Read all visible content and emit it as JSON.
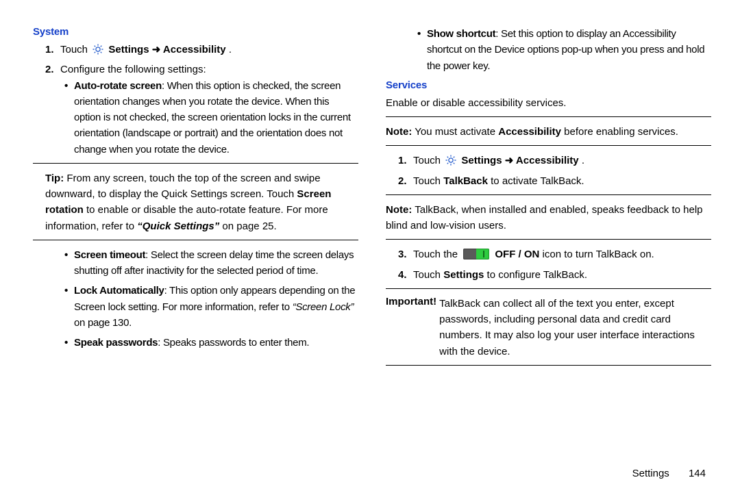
{
  "left": {
    "heading": "System",
    "step1_pre": "Touch ",
    "step1_settings": "Settings",
    "step1_arrow": " ➜ ",
    "step1_acc": "Accessibility",
    "step1_post": ".",
    "step2": "Configure the following settings:",
    "b1_strong": "Auto-rotate screen",
    "b1_rest": ": When this option is checked, the screen orientation changes when you rotate the device. When this option is not checked, the screen orientation locks in the current orientation (landscape or portrait) and the orientation does not change when you rotate the device.",
    "tip_label": "Tip:",
    "tip_body1": " From any screen, touch the top of the screen and swipe downward, to display the Quick Settings screen. Touch ",
    "tip_strong": "Screen rotation",
    "tip_body2": " to enable or disable the auto-rotate feature. For more information, refer to ",
    "tip_ital": "“Quick Settings”",
    "tip_body3": " on page 25.",
    "b2_strong": "Screen timeout",
    "b2_rest": ": Select the screen delay time the screen delays shutting off after inactivity for the selected period of time.",
    "b3_strong": "Lock Automatically",
    "b3_rest": ": This option only appears depending on the Screen lock setting. For more information, refer to ",
    "b3_ital": "“Screen Lock”",
    "b3_rest2": " on page 130.",
    "b4_strong": "Speak passwords",
    "b4_rest": ": Speaks passwords to enter them."
  },
  "right": {
    "top_bullet_strong": "Show shortcut",
    "top_bullet_rest": ": Set this option to display an Accessibility shortcut on the Device options pop-up when you press and hold the power key.",
    "heading": "Services",
    "intro": "Enable or disable accessibility services.",
    "note1_label": "Note:",
    "note1_body1": " You must activate ",
    "note1_strong": "Accessibility",
    "note1_body2": " before enabling services.",
    "step1_pre": "Touch ",
    "step1_settings": "Settings",
    "step1_arrow": " ➜ ",
    "step1_acc": "Accessibility",
    "step1_post": ".",
    "step2_pre": "Touch ",
    "step2_strong": "TalkBack",
    "step2_post": " to activate TalkBack.",
    "note2_label": "Note:",
    "note2_body": " TalkBack, when installed and enabled, speaks feedback to help blind and low-vision users.",
    "step3_pre": "Touch the ",
    "step3_strong": "OFF / ON",
    "step3_post": " icon to turn TalkBack on.",
    "step4_pre": "Touch ",
    "step4_strong": "Settings",
    "step4_post": " to configure TalkBack.",
    "imp_label": "Important! ",
    "imp_body": "TalkBack can collect all of the text you enter, except passwords, including personal data and credit card numbers. It may also log your user interface interactions with the device."
  },
  "footer": {
    "section": "Settings",
    "page": "144"
  }
}
